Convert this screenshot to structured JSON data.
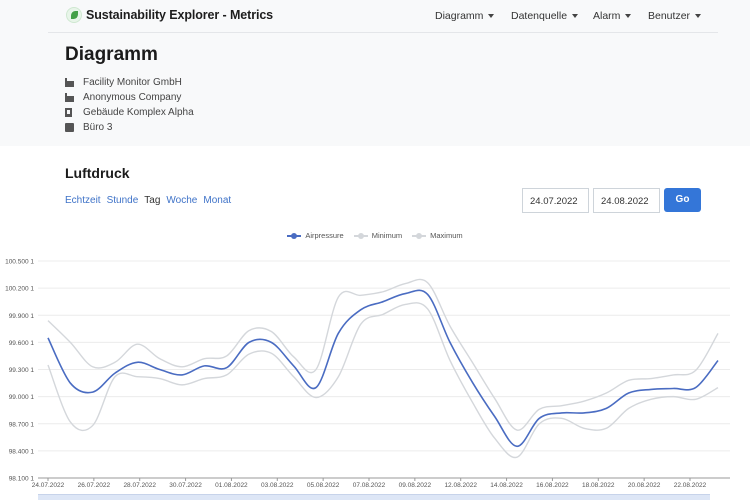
{
  "app": {
    "title": "Sustainability Explorer - Metrics",
    "nav": [
      {
        "label": "Diagramm"
      },
      {
        "label": "Datenquelle"
      },
      {
        "label": "Alarm"
      },
      {
        "label": "Benutzer"
      }
    ]
  },
  "page": {
    "title": "Diagramm",
    "info": [
      {
        "icon": "factory-icon",
        "label": "Facility Monitor GmbH"
      },
      {
        "icon": "factory-icon",
        "label": "Anonymous Company"
      },
      {
        "icon": "building-icon",
        "label": "Gebäude Komplex Alpha"
      },
      {
        "icon": "cube-icon",
        "label": "Büro 3"
      }
    ]
  },
  "chart_section": {
    "title": "Luftdruck",
    "ranges": [
      {
        "label": "Echtzeit",
        "active": false
      },
      {
        "label": "Stunde",
        "active": false
      },
      {
        "label": "Tag",
        "active": true
      },
      {
        "label": "Woche",
        "active": false
      },
      {
        "label": "Monat",
        "active": false
      }
    ],
    "date_from": "24.07.2022",
    "date_to": "24.08.2022",
    "go_label": "Go"
  },
  "colors": {
    "primary": "#3476d8",
    "series_main": "#4a6cc2",
    "series_bounds": "#d4d7db"
  },
  "chart_data": {
    "type": "line",
    "title": "",
    "xlabel": "",
    "ylabel": "",
    "ylim": [
      98100,
      100500
    ],
    "yticks": [
      {
        "v": 100500,
        "label": "100.500 1"
      },
      {
        "v": 100200,
        "label": "100.200 1"
      },
      {
        "v": 99900,
        "label": "99.900 1"
      },
      {
        "v": 99600,
        "label": "99.600 1"
      },
      {
        "v": 99300,
        "label": "99.300 1"
      },
      {
        "v": 99000,
        "label": "99.000 1"
      },
      {
        "v": 98700,
        "label": "98.700 1"
      },
      {
        "v": 98400,
        "label": "98.400 1"
      },
      {
        "v": 98100,
        "label": "98.100 1"
      }
    ],
    "xticks": [
      "24.07.2022",
      "26.07.2022",
      "28.07.2022",
      "30.07.2022",
      "01.08.2022",
      "03.08.2022",
      "05.08.2022",
      "07.08.2022",
      "09.08.2022",
      "12.08.2022",
      "14.08.2022",
      "16.08.2022",
      "18.08.2022",
      "20.08.2022",
      "22.08.2022"
    ],
    "legend_position": "top-center",
    "grid": true,
    "series": [
      {
        "name": "Airpressure",
        "color": "#4a6cc2",
        "values": [
          99650,
          99150,
          99050,
          99260,
          99380,
          99300,
          99240,
          99340,
          99320,
          99600,
          99600,
          99340,
          99100,
          99700,
          99960,
          100050,
          100140,
          100130,
          99600,
          99160,
          98780,
          98450,
          98760,
          98820,
          98820,
          98870,
          99040,
          99080,
          99090,
          99100,
          99400
        ]
      },
      {
        "name": "Minimum",
        "color": "#d4d7db",
        "values": [
          99350,
          98720,
          98680,
          99220,
          99220,
          99200,
          99130,
          99200,
          99240,
          99470,
          99480,
          99220,
          98990,
          99220,
          99800,
          99910,
          100020,
          99970,
          99400,
          98940,
          98540,
          98330,
          98700,
          98760,
          98650,
          98650,
          98870,
          98970,
          99000,
          98970,
          99100
        ]
      },
      {
        "name": "Maximum",
        "color": "#d4d7db",
        "values": [
          99840,
          99600,
          99330,
          99380,
          99580,
          99420,
          99330,
          99420,
          99450,
          99730,
          99720,
          99440,
          99300,
          100100,
          100120,
          100160,
          100250,
          100260,
          99780,
          99380,
          98980,
          98630,
          98860,
          98900,
          98950,
          99040,
          99180,
          99200,
          99240,
          99290,
          99700
        ]
      }
    ]
  }
}
